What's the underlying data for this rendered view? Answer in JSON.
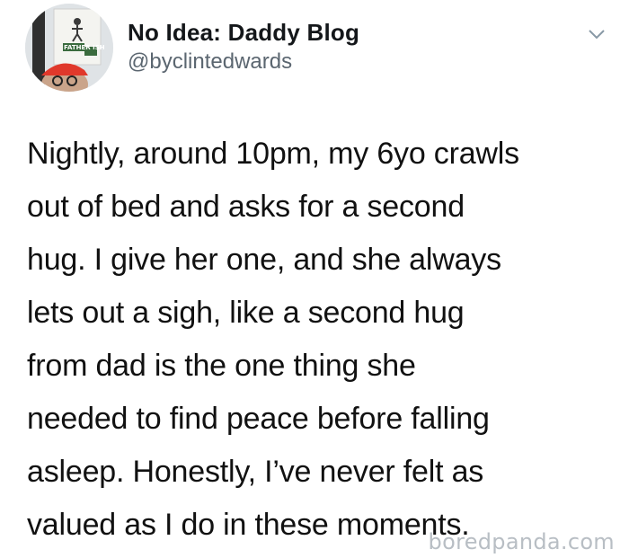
{
  "author": {
    "display_name": "No Idea: Daddy Blog",
    "handle": "@byclintedwards",
    "avatar_sign_text": "FATHER ISH"
  },
  "tweet": {
    "lines": [
      "Nightly, around 10pm, my 6yo crawls",
      "out of bed and asks for a second",
      "hug. I give her one, and she always",
      "lets out a sigh, like a second hug",
      "from dad is the one thing she",
      "needed to find peace before falling",
      "asleep. Honestly, I’ve never felt as",
      "valued as I do in these moments."
    ]
  },
  "watermark": "boredpanda.com",
  "icons": {
    "more": "chevron-down-icon"
  },
  "colors": {
    "text": "#14171a",
    "handle": "#5b6670",
    "caret": "#8899a6",
    "watermark": "#b8bec4",
    "cap": "#e0382b"
  }
}
